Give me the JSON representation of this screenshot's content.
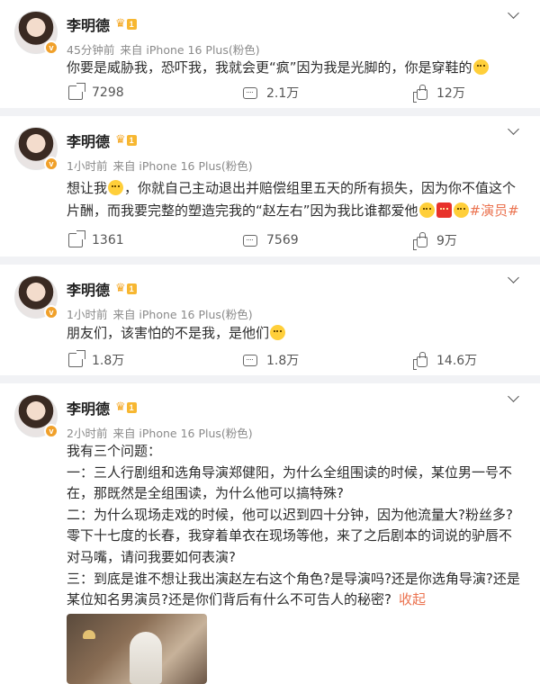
{
  "posts": [
    {
      "user": "李明德",
      "level": "1",
      "time": "45分钟前",
      "source": "来自 iPhone 16 Plus(粉色)",
      "text_parts": [
        "你要是威胁我，恐吓我，我就会更“疯”因为我是光脚的，你是穿鞋的"
      ],
      "reposts": "7298",
      "comments": "2.1万",
      "likes": "12万"
    },
    {
      "user": "李明德",
      "level": "1",
      "time": "1小时前",
      "source": "来自 iPhone 16 Plus(粉色)",
      "text_parts": [
        "想让我",
        "，你就自己主动退出并赔偿组里五天的所有损失，因为你不值这个片酬，而我要完整的塑造完我的“赵左右”因为我比谁都爱他",
        "#演员#"
      ],
      "reposts": "1361",
      "comments": "7569",
      "likes": "9万"
    },
    {
      "user": "李明德",
      "level": "1",
      "time": "1小时前",
      "source": "来自 iPhone 16 Plus(粉色)",
      "text_parts": [
        "朋友们，该害怕的不是我，是他们"
      ],
      "reposts": "1.8万",
      "comments": "1.8万",
      "likes": "14.6万"
    },
    {
      "user": "李明德",
      "level": "1",
      "time": "2小时前",
      "source": "来自 iPhone 16 Plus(粉色)",
      "lines": [
        "我有三个问题：",
        "一：三人行剧组和选角导演郑健阳，为什么全组围读的时候，某位男一号不在，那既然是全组围读，为什么他可以搞特殊?",
        "二：为什么现场走戏的时候，他可以迟到四十分钟，因为他流量大?粉丝多?零下十七度的长春，我穿着单衣在现场等他，来了之后剧本的词说的驴唇不对马嘴，请问我要如何表演?",
        "三：到底是谁不想让我出演赵左右这个角色?是导演吗?还是你选角导演?还是某位知名男演员?还是你们背后有什么不可告人的秘密?"
      ],
      "collapse": "收起"
    }
  ]
}
